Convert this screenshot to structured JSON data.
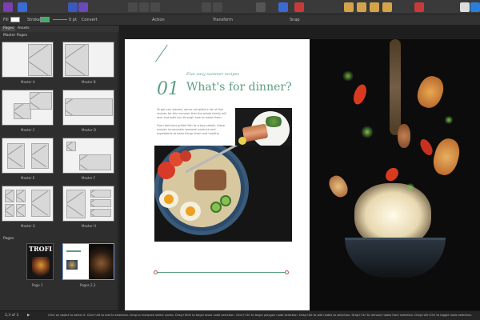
{
  "toolbar": {
    "icons": [
      "affinity-publisher-icon",
      "designer-persona-icon",
      "photo-persona-icon",
      "document-icon",
      "view-icon",
      "pen-icon",
      "node-icon",
      "color-icon",
      "align-icon",
      "arrange-icon",
      "boolean-icon",
      "chat-icon",
      "studio-icon"
    ]
  },
  "context": {
    "fill_label": "Fill",
    "stroke_label": "Stroke",
    "stroke_width": "0 pt",
    "convert_label": "Convert",
    "action_label": "Action",
    "transform_label": "Transform",
    "snap_label": "Snap"
  },
  "panel": {
    "tabs": [
      "Pages",
      "Assets"
    ],
    "master_header": "Master Pages",
    "masters": [
      "Master A",
      "Master B",
      "Master C",
      "Master D",
      "Master E",
      "Master F",
      "Master G",
      "Master H"
    ],
    "pages_header": "Pages",
    "pages": [
      "Page 1",
      "Pages 2,3"
    ],
    "cover_title": "TROFI"
  },
  "spread": {
    "kicker": "Five easy summer recipes",
    "number": "01",
    "heading": "What's for dinner?",
    "body1": "To get you started, we've compiled a list of five recipes for this summer that the whole family will love and walk you through how to make them.",
    "body2": "From delicious grilled fish to crispy salads, these recipes incorporate seasonal produce and ingredients to keep things fresh and healthy."
  },
  "status": {
    "page_count": "2,3 of 3",
    "hint": "Click on object to select it. Click+Alt to add to selection. Drag to marquee select nodes. Drag+Shift to begin lasso node selection. Click+Ctrl to begin polygon node selection. Drag+Alt to add nodes to selection. Drag+Ctrl to remove nodes from selection. Drag+Alt+Ctrl to toggle node selection."
  },
  "colors": {
    "accent": "#5a9e7e",
    "stroke_swatch": "#3fb06a"
  }
}
